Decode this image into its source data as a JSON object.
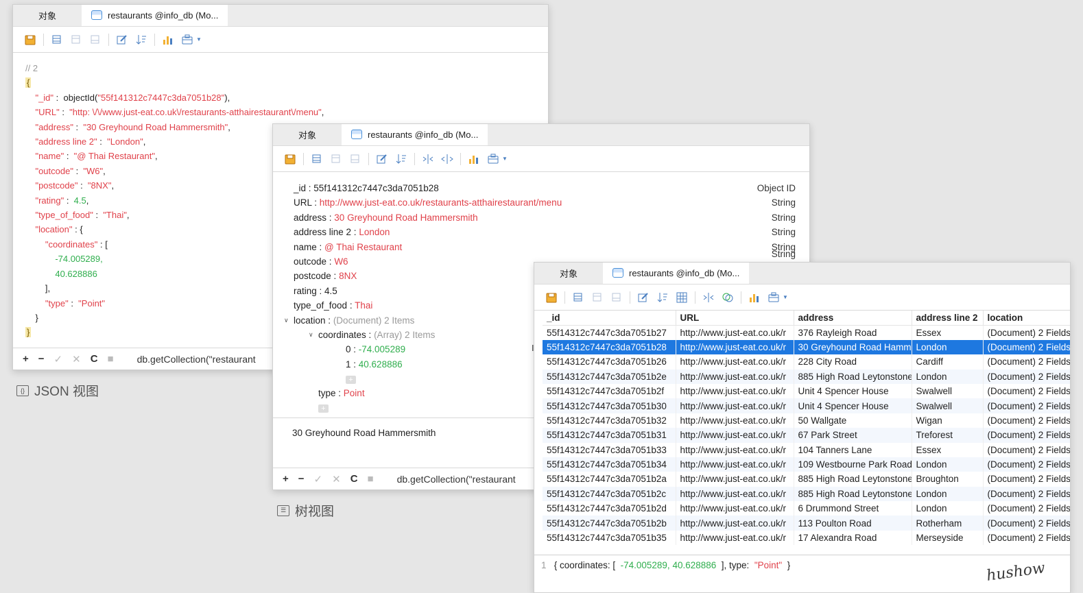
{
  "tabs": {
    "objects": "对象",
    "collection": "restaurants @info_db (Mo..."
  },
  "json_view": {
    "comment": "// 2",
    "open_brace": "{",
    "close_brace": "}",
    "id_key": "\"_id\"",
    "id_fn": "objectId(",
    "id_val": "\"55f141312c7447c3da7051b28\"",
    "id_end": "),",
    "url_key": "\"URL\"",
    "url_val": "\"http: \\/\\/www.just-eat.co.uk\\/restaurants-atthairestaurant\\/menu\"",
    "address_key": "\"address\"",
    "address_val": "\"30 Greyhound Road Hammersmith\"",
    "address2_key": "\"address line 2\"",
    "address2_val": "\"London\"",
    "name_key": "\"name\"",
    "name_val": "\"@ Thai Restaurant\"",
    "outcode_key": "\"outcode\"",
    "outcode_val": "\"W6\"",
    "postcode_key": "\"postcode\"",
    "postcode_val": "\"8NX\"",
    "rating_key": "\"rating\"",
    "rating_val": "4.5",
    "food_key": "\"type_of_food\"",
    "food_val": "\"Thai\"",
    "location_key": "\"location\"",
    "coords_key": "\"coordinates\"",
    "coord0": "-74.005289,",
    "coord1": "40.628886",
    "type_key": "\"type\"",
    "type_val": "\"Point\"",
    "query": "db.getCollection(\"restaurant",
    "caption": "JSON 视图"
  },
  "tree_view": {
    "rows": {
      "id_k": "_id :",
      "id_v": "55f141312c7447c3da7051b28",
      "id_t": "Object ID",
      "url_k": "URL :",
      "url_v": "http://www.just-eat.co.uk/restaurants-atthairestaurant/menu",
      "url_t": "String",
      "addr_k": "address :",
      "addr_v": "30 Greyhound Road Hammersmith",
      "addr_t": "String",
      "addr2_k": "address line 2 :",
      "addr2_v": "London",
      "addr2_t": "String",
      "name_k": "name :",
      "name_v": "@ Thai Restaurant",
      "name_t": "String",
      "out_k": "outcode :",
      "out_v": "W6",
      "out_t": "String",
      "post_k": "postcode :",
      "post_v": "8NX",
      "rate_k": "rating :",
      "rate_v": "4.5",
      "food_k": "type_of_food :",
      "food_v": "Thai",
      "loc_k": "location :",
      "loc_v": "(Document) 2 Items",
      "coord_k": "coordinates :",
      "coord_v": "(Array) 2 Items",
      "c0_k": "0 :",
      "c0_v": "-74.005289",
      "c1_k": "1 :",
      "c1_v": "40.628886",
      "type_k": "type :",
      "type_v": "Point",
      "plus": "+"
    },
    "status": "30 Greyhound Road Hammersmith",
    "query": "db.getCollection(\"restaurant",
    "caption": "树视图"
  },
  "grid_view": {
    "columns": [
      "_id",
      "URL",
      "address",
      "address line 2",
      "location"
    ],
    "rows": [
      [
        "55f14312c7447c3da7051b27",
        "http://www.just-eat.co.uk/r",
        "376 Rayleigh Road",
        "Essex",
        "(Document) 2 Fields"
      ],
      [
        "55f14312c7447c3da7051b28",
        "http://www.just-eat.co.uk/r",
        "30 Greyhound Road Hamm",
        "London",
        "(Document) 2 Fields"
      ],
      [
        "55f14312c7447c3da7051b26",
        "http://www.just-eat.co.uk/r",
        "228 City Road",
        "Cardiff",
        "(Document) 2 Fields"
      ],
      [
        "55f14312c7447c3da7051b2e",
        "http://www.just-eat.co.uk/r",
        "885 High Road Leytonstone",
        "London",
        "(Document) 2 Fields"
      ],
      [
        "55f14312c7447c3da7051b2f",
        "http://www.just-eat.co.uk/r",
        "Unit 4 Spencer House",
        "Swalwell",
        "(Document) 2 Fields"
      ],
      [
        "55f14312c7447c3da7051b30",
        "http://www.just-eat.co.uk/r",
        "Unit 4 Spencer House",
        "Swalwell",
        "(Document) 2 Fields"
      ],
      [
        "55f14312c7447c3da7051b32",
        "http://www.just-eat.co.uk/r",
        "50 Wallgate",
        "Wigan",
        "(Document) 2 Fields"
      ],
      [
        "55f14312c7447c3da7051b31",
        "http://www.just-eat.co.uk/r",
        "67 Park Street",
        "Treforest",
        "(Document) 2 Fields"
      ],
      [
        "55f14312c7447c3da7051b33",
        "http://www.just-eat.co.uk/r",
        "104 Tanners Lane",
        "Essex",
        "(Document) 2 Fields"
      ],
      [
        "55f14312c7447c3da7051b34",
        "http://www.just-eat.co.uk/r",
        "109 Westbourne Park Road",
        "London",
        "(Document) 2 Fields"
      ],
      [
        "55f14312c7447c3da7051b2a",
        "http://www.just-eat.co.uk/r",
        "885 High Road Leytonstone",
        "Broughton",
        "(Document) 2 Fields"
      ],
      [
        "55f14312c7447c3da7051b2c",
        "http://www.just-eat.co.uk/r",
        "885 High Road Leytonstone",
        "London",
        "(Document) 2 Fields"
      ],
      [
        "55f14312c7447c3da7051b2d",
        "http://www.just-eat.co.uk/r",
        "6 Drummond Street",
        "London",
        "(Document) 2 Fields"
      ],
      [
        "55f14312c7447c3da7051b2b",
        "http://www.just-eat.co.uk/r",
        "113 Poulton Road",
        "Rotherham",
        "(Document) 2 Fields"
      ],
      [
        "55f14312c7447c3da7051b35",
        "http://www.just-eat.co.uk/r",
        "17 Alexandra Road",
        "Merseyside",
        "(Document) 2 Fields"
      ]
    ],
    "footer": {
      "line": "1",
      "open": "{ coordinates: [",
      "c0": "-74.005289,",
      "c1": "40.628886",
      "mid": "], type:",
      "type": "\"Point\"",
      "close": "}"
    }
  },
  "signature": "hushow"
}
